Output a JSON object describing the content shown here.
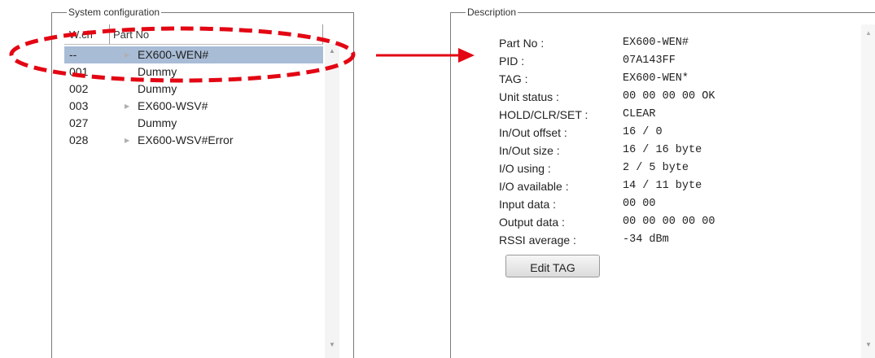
{
  "system_config": {
    "title": "System configuration",
    "columns": {
      "wch": "W.ch",
      "part_no": "Part No"
    },
    "rows": [
      {
        "ch": "--",
        "part": "EX600-WEN#",
        "expandable": true,
        "selected": true
      },
      {
        "ch": "001",
        "part": "Dummy",
        "expandable": false,
        "selected": false
      },
      {
        "ch": "002",
        "part": "Dummy",
        "expandable": false,
        "selected": false
      },
      {
        "ch": "003",
        "part": "EX600-WSV#",
        "expandable": true,
        "selected": false
      },
      {
        "ch": "027",
        "part": "Dummy",
        "expandable": false,
        "selected": false
      },
      {
        "ch": "028",
        "part": "EX600-WSV#Error",
        "expandable": true,
        "selected": false
      }
    ],
    "scroll_up_icon": "▲",
    "scroll_down_icon": "▼"
  },
  "description": {
    "title": "Description",
    "fields": [
      {
        "label": "Part No :",
        "value": "EX600-WEN#"
      },
      {
        "label": "PID :",
        "value": "07A143FF"
      },
      {
        "label": "TAG :",
        "value": "EX600-WEN*"
      },
      {
        "label": "Unit status :",
        "value": "00 00 00 00 OK"
      },
      {
        "label": "HOLD/CLR/SET :",
        "value": "CLEAR"
      },
      {
        "label": "In/Out offset :",
        "value": "16 / 0"
      },
      {
        "label": "In/Out size :",
        "value": "16 / 16 byte"
      },
      {
        "label": "I/O using :",
        "value": "2 / 5 byte"
      },
      {
        "label": "I/O available :",
        "value": "14 / 11 byte"
      },
      {
        "label": "Input data :",
        "value": "00 00"
      },
      {
        "label": "Output data :",
        "value": "00 00 00 00 00"
      },
      {
        "label": "RSSI average :",
        "value": "-34 dBm"
      }
    ],
    "edit_button": "Edit TAG",
    "scroll_up_icon": "▲",
    "scroll_down_icon": "▼"
  },
  "annotation_colors": {
    "highlight": "#e30613",
    "selection": "#a8bcd6"
  }
}
